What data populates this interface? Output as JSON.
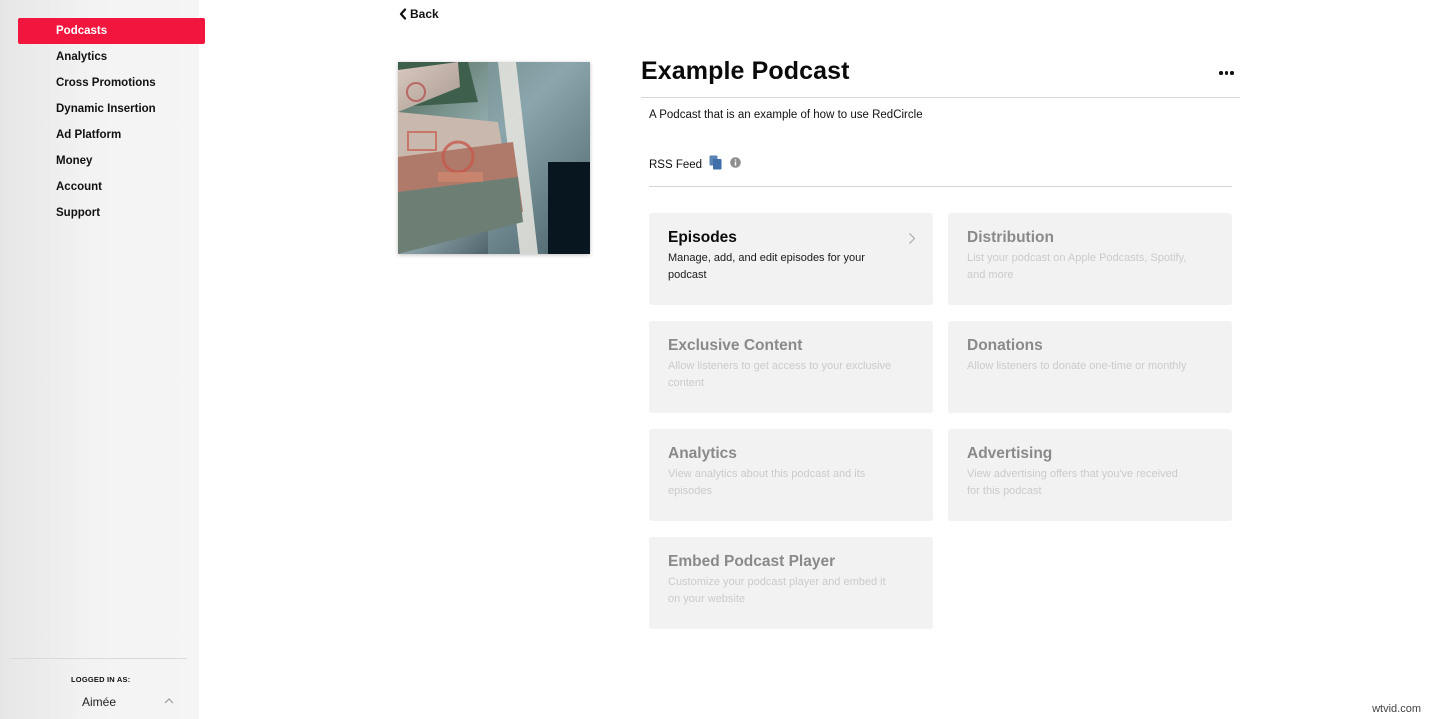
{
  "sidebar": {
    "items": [
      {
        "label": "Podcasts",
        "active": true
      },
      {
        "label": "Analytics",
        "active": false
      },
      {
        "label": "Cross Promotions",
        "active": false
      },
      {
        "label": "Dynamic Insertion",
        "active": false
      },
      {
        "label": "Ad Platform",
        "active": false
      },
      {
        "label": "Money",
        "active": false
      },
      {
        "label": "Account",
        "active": false
      },
      {
        "label": "Support",
        "active": false
      }
    ],
    "logged_in_label": "LOGGED IN AS:",
    "user_name": "Aimée",
    "user_menu_icon": "chevron-up-icon"
  },
  "back": {
    "label": "Back",
    "icon": "chevron-left-icon"
  },
  "podcast": {
    "title": "Example Podcast",
    "description": "A Podcast that is an example of how to use RedCircle",
    "rss_label": "RSS Feed",
    "more_icon": "ellipsis-icon"
  },
  "cards": [
    {
      "title": "Episodes",
      "desc": "Manage, add, and edit episodes for your podcast",
      "enabled": true
    },
    {
      "title": "Distribution",
      "desc": "List your podcast on Apple Podcasts, Spotify, and more",
      "enabled": false
    },
    {
      "title": "Exclusive Content",
      "desc": "Allow listeners to get access to your exclusive content",
      "enabled": false
    },
    {
      "title": "Donations",
      "desc": "Allow listeners to donate one-time or monthly",
      "enabled": false
    },
    {
      "title": "Analytics",
      "desc": "View analytics about this podcast and its episodes",
      "enabled": false
    },
    {
      "title": "Advertising",
      "desc": "View advertising offers that you've received for this podcast",
      "enabled": false
    },
    {
      "title": "Embed Podcast Player",
      "desc": "Customize your podcast player and embed it on your website",
      "enabled": false
    }
  ],
  "colors": {
    "accent": "#f2163e",
    "card_bg": "#f2f2f2",
    "copy_icon": "#3f6fa8"
  },
  "watermark": "wtvid.com"
}
